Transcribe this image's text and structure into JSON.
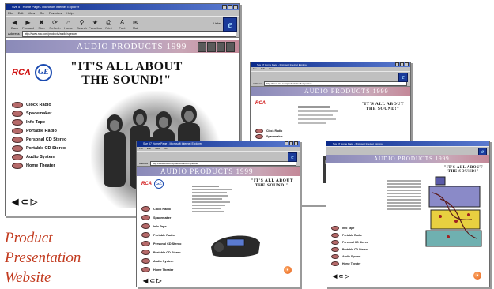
{
  "page_title_lines": [
    "Product",
    "Presentation",
    "Website"
  ],
  "browser": {
    "title": "Sve 57 Home Page - Microsoft Internet Explorer",
    "menu": [
      "File",
      "Edit",
      "View",
      "Go",
      "Favorites",
      "Help"
    ],
    "toolbar": [
      {
        "label": "Back",
        "icon": "back-arrow-icon",
        "glyph": "◀"
      },
      {
        "label": "Forward",
        "icon": "forward-arrow-icon",
        "glyph": "▶"
      },
      {
        "label": "Stop",
        "icon": "stop-icon",
        "glyph": "✖"
      },
      {
        "label": "Refresh",
        "icon": "refresh-icon",
        "glyph": "⟳"
      },
      {
        "label": "Home",
        "icon": "home-icon",
        "glyph": "⌂"
      },
      {
        "label": "Search",
        "icon": "search-icon",
        "glyph": "⚲"
      },
      {
        "label": "Favorites",
        "icon": "favorites-icon",
        "glyph": "★"
      },
      {
        "label": "Print",
        "icon": "print-icon",
        "glyph": "⎙"
      },
      {
        "label": "Font",
        "icon": "font-icon",
        "glyph": "A"
      },
      {
        "label": "Mail",
        "icon": "mail-icon",
        "glyph": "✉"
      }
    ],
    "address_label": "Address",
    "address_value": "http://www.rca.com/products/audio/speaker",
    "links_label": "Links"
  },
  "site": {
    "banner": "AUDIO PRODUCTS 1999",
    "rca_logo": "RCA",
    "ge_logo": "GE",
    "slogan_lines": [
      "\"IT'S ALL ABOUT",
      "THE SOUND!\""
    ],
    "nav": [
      "Clock Radio",
      "Spacemaker",
      "Info Tape",
      "Portable Radio",
      "Personal CD Stereo",
      "Portable CD Stereo",
      "Audio System",
      "Home Theater"
    ],
    "arrows": "◀ ⊂ ▷"
  },
  "colors": {
    "banner_start": "#8a8ab8",
    "banner_end": "#c48898",
    "title_red": "#c23a1e",
    "rca_red": "#d01010",
    "ge_blue": "#1a4ab0",
    "ie_blue": "#1a3a9a"
  }
}
